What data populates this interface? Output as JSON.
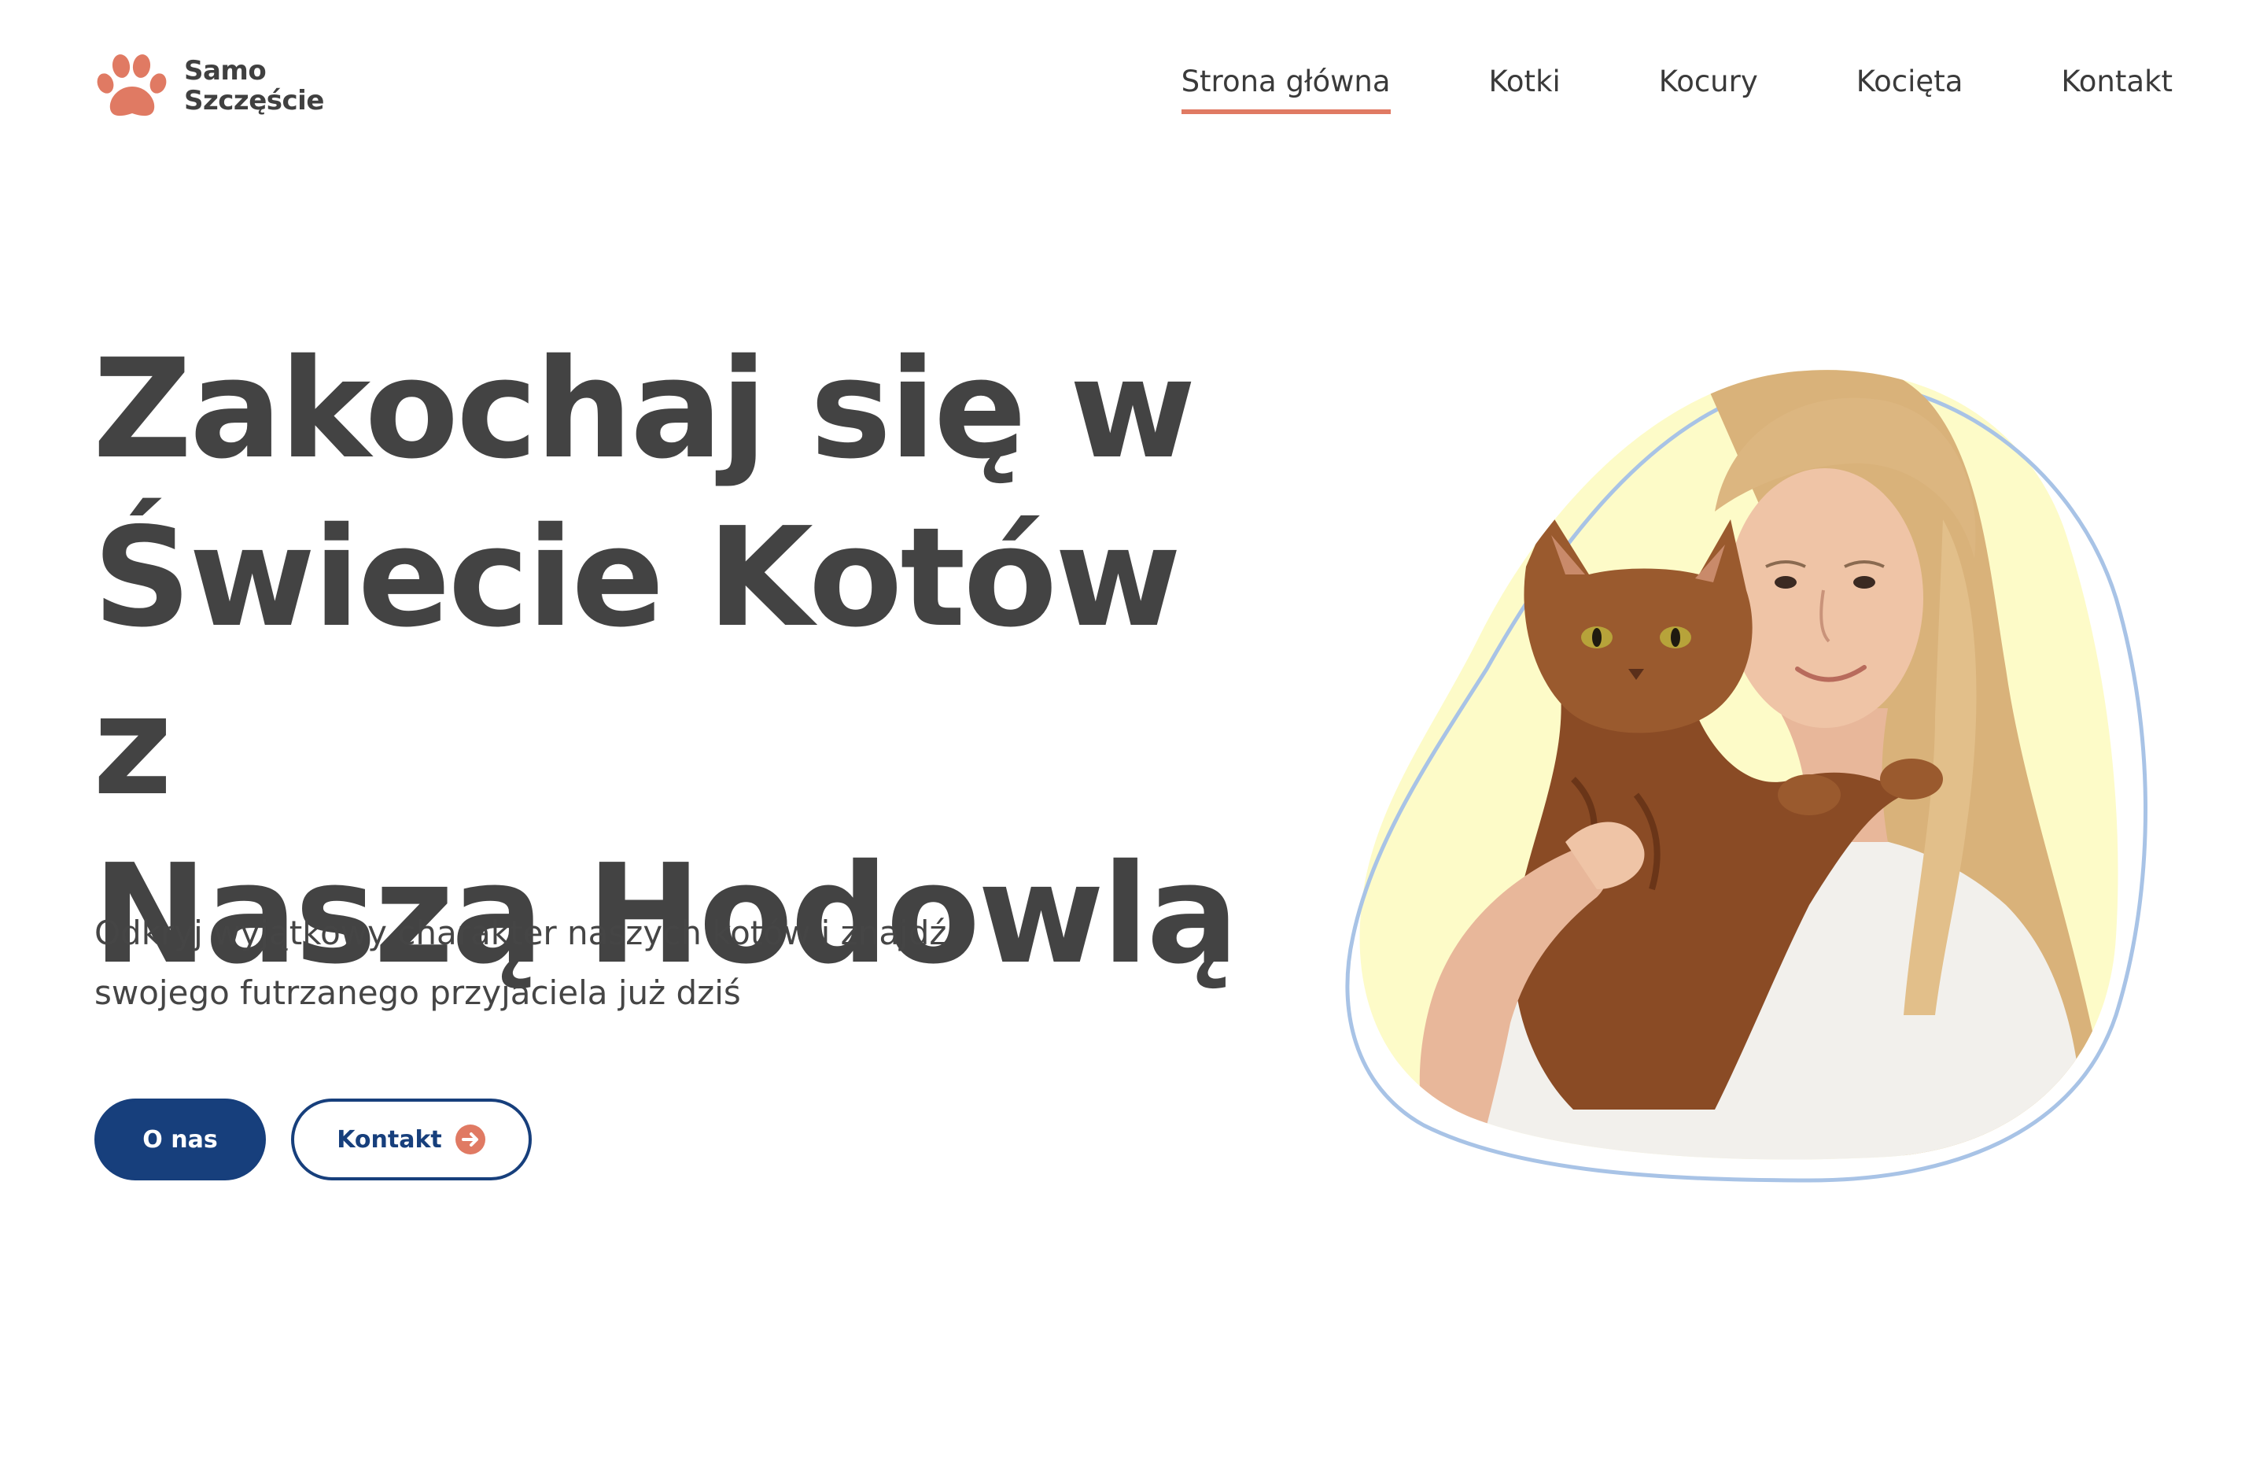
{
  "brand": {
    "name_line1": "Samo",
    "name_line2": "Szczęście",
    "logo_icon": "paw-icon",
    "accent_color": "#e07a63"
  },
  "nav": {
    "items": [
      {
        "label": "Strona główna",
        "active": true
      },
      {
        "label": "Kotki",
        "active": false
      },
      {
        "label": "Kocury",
        "active": false
      },
      {
        "label": "Kocięta",
        "active": false
      },
      {
        "label": "Kontakt",
        "active": false
      }
    ]
  },
  "hero": {
    "title_line1": "Zakochaj się w",
    "title_line2": "Świecie Kotów z",
    "title_line3": "Naszą Hodowlą",
    "subtitle_line1": "Odkryj wyjątkowy charakter naszych kotów i znajdź",
    "subtitle_line2": "swojego futrzanego przyjaciela już dziś",
    "primary_button": "O nas",
    "secondary_button": "Kontakt",
    "secondary_button_icon": "arrow-right-circle-icon",
    "button_color": "#173f7c",
    "blob_color": "#fdfbc8",
    "outline_color": "#a8c3e6"
  }
}
